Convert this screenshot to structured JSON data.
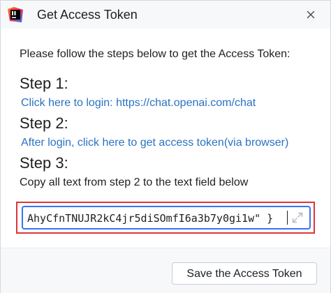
{
  "window": {
    "title": "Get Access Token",
    "app_icon": "intellij-idea-icon",
    "close_icon": "close-icon"
  },
  "content": {
    "intro": "Please follow the steps below to get the Access Token:",
    "step1": {
      "heading": "Step 1:",
      "link": "Click here to login: https://chat.openai.com/chat"
    },
    "step2": {
      "heading": "Step 2:",
      "link": "After login, click here to get access token(via browser)"
    },
    "step3": {
      "heading": "Step 3:",
      "description": "Copy all text from step 2 to the text field below"
    },
    "token_field": {
      "value": "AhyCfnTNUJR2kC4jr5diSOmfI6a3b7y0gi1w\" }",
      "expand_icon": "expand-icon"
    }
  },
  "footer": {
    "save_label": "Save the Access Token"
  },
  "colors": {
    "link": "#2a72c3",
    "focus_border": "#3574f0",
    "highlight_outline": "#e0333b"
  }
}
